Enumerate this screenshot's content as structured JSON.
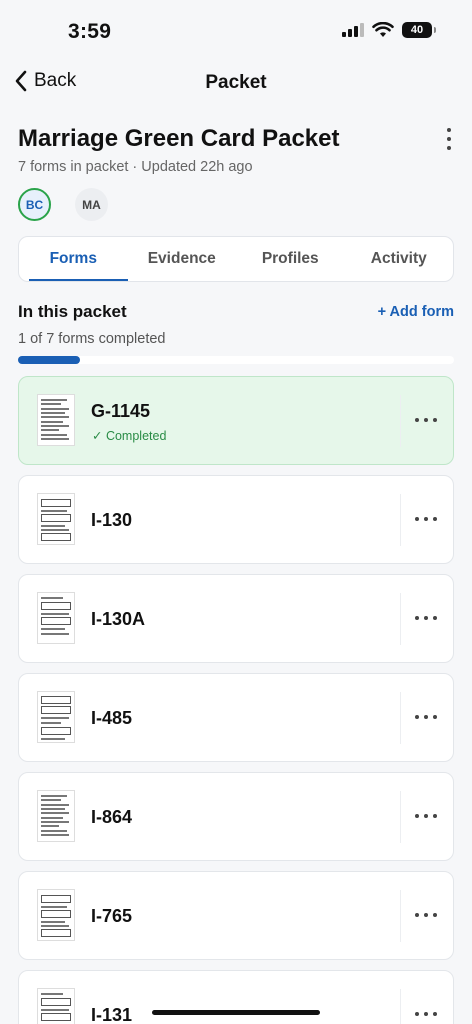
{
  "status_bar": {
    "time": "3:59",
    "battery": "40"
  },
  "nav": {
    "back_label": "Back",
    "title": "Packet"
  },
  "packet": {
    "title": "Marriage Green Card Packet",
    "subtitle": "7 forms in packet · Updated 22h ago",
    "members": [
      {
        "initials": "BC"
      },
      {
        "initials": "MA"
      }
    ]
  },
  "tabs": [
    {
      "label": "Forms",
      "active": true
    },
    {
      "label": "Evidence",
      "active": false
    },
    {
      "label": "Profiles",
      "active": false
    },
    {
      "label": "Activity",
      "active": false
    }
  ],
  "section": {
    "title": "In this packet",
    "add_label": "+ Add form",
    "progress_text": "1 of 7 forms completed",
    "progress_fraction": 0.142
  },
  "forms": [
    {
      "name": "G-1145",
      "status": "✓ Completed",
      "completed": true
    },
    {
      "name": "I-130",
      "status": "",
      "completed": false
    },
    {
      "name": "I-130A",
      "status": "",
      "completed": false
    },
    {
      "name": "I-485",
      "status": "",
      "completed": false
    },
    {
      "name": "I-864",
      "status": "",
      "completed": false
    },
    {
      "name": "I-765",
      "status": "",
      "completed": false
    },
    {
      "name": "I-131",
      "status": "",
      "completed": false
    }
  ],
  "colors": {
    "accent": "#1a5fb4",
    "completed_bg": "#e6f7ea",
    "completed_text": "#2a8c46"
  }
}
